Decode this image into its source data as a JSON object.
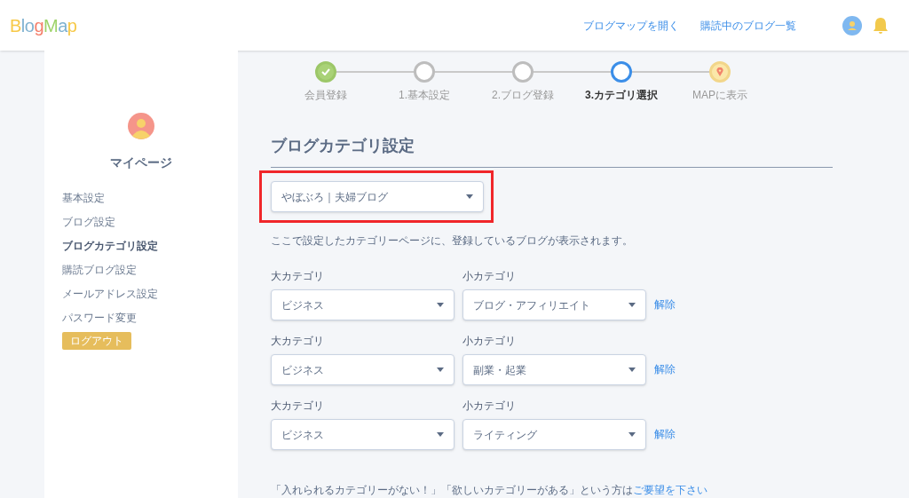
{
  "header": {
    "logo": [
      {
        "text": "B",
        "color": "#f7c948"
      },
      {
        "text": "lo",
        "color": "#7fb2d0"
      },
      {
        "text": "g",
        "color": "#f47f6b"
      },
      {
        "text": "M",
        "color": "#9ed36a"
      },
      {
        "text": "a",
        "color": "#7fb2d0"
      },
      {
        "text": "p",
        "color": "#f7c948"
      }
    ],
    "links": [
      "ブログマップを開く",
      "購読中のブログ一覧"
    ]
  },
  "sidebar": {
    "title": "マイページ",
    "items": [
      {
        "label": "基本設定",
        "selected": false
      },
      {
        "label": "ブログ設定",
        "selected": false
      },
      {
        "label": "ブログカテゴリ設定",
        "selected": true
      },
      {
        "label": "購読ブログ設定",
        "selected": false
      },
      {
        "label": "メールアドレス設定",
        "selected": false
      },
      {
        "label": "パスワード変更",
        "selected": false
      }
    ],
    "logout": "ログアウト"
  },
  "steps": [
    {
      "label": "会員登録",
      "kind": "done"
    },
    {
      "label": "1.基本設定",
      "kind": "todo"
    },
    {
      "label": "2.ブログ登録",
      "kind": "todo"
    },
    {
      "label": "3.カテゴリ選択",
      "kind": "current"
    },
    {
      "label": "MAPに表示",
      "kind": "goal"
    }
  ],
  "title": "ブログカテゴリ設定",
  "blog_select": {
    "value": "やぼぶろ｜夫婦ブログ",
    "highlighted": true
  },
  "note": "ここで設定したカテゴリーページに、登録しているブログが表示されます。",
  "categories": [
    {
      "major_label": "大カテゴリ",
      "major": "ビジネス",
      "minor_label": "小カテゴリ",
      "minor": "ブログ・アフィリエイト",
      "remove": "解除"
    },
    {
      "major_label": "大カテゴリ",
      "major": "ビジネス",
      "minor_label": "小カテゴリ",
      "minor": "副業・起業",
      "remove": "解除"
    },
    {
      "major_label": "大カテゴリ",
      "major": "ビジネス",
      "minor_label": "小カテゴリ",
      "minor": "ライティング",
      "remove": "解除"
    }
  ],
  "footer_note": {
    "text": "「入れられるカテゴリーがない！」「欲しいカテゴリーがある」という方は",
    "link": "ご要望を下さい"
  }
}
